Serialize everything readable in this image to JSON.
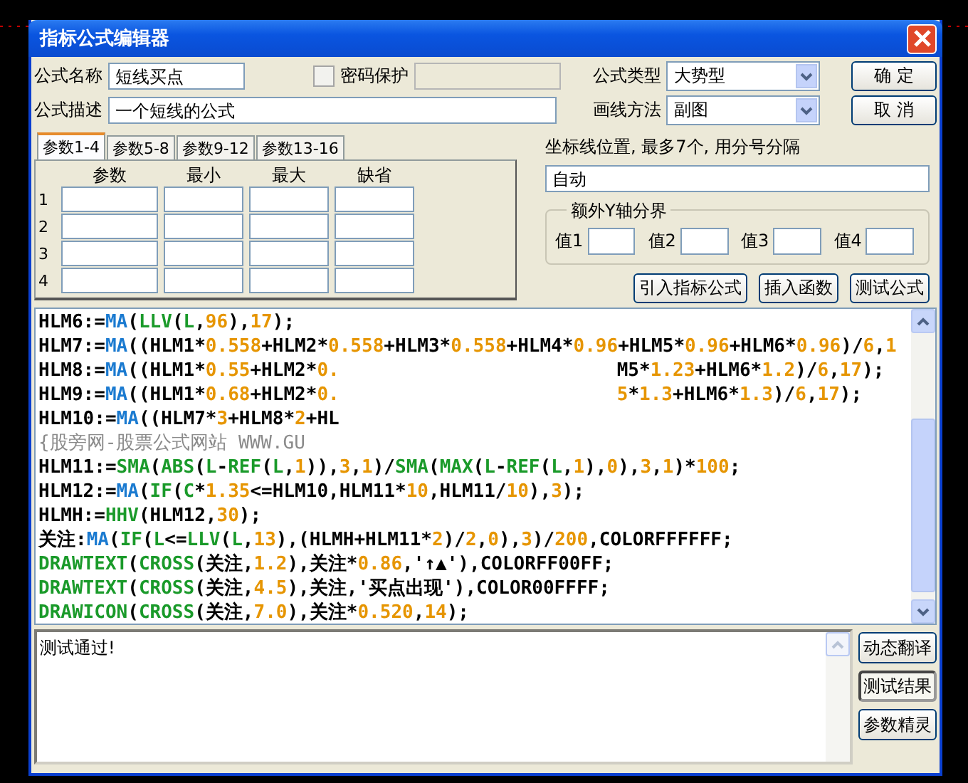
{
  "window": {
    "title": "指标公式编辑器"
  },
  "fields": {
    "name": {
      "label": "公式名称",
      "value": "短线买点"
    },
    "password": {
      "label": "密码保护",
      "checked": false
    },
    "description": {
      "label": "公式描述",
      "value": "一个短线的公式"
    },
    "formula_type": {
      "label": "公式类型",
      "value": "大势型"
    },
    "draw_method": {
      "label": "画线方法",
      "value": "副图"
    }
  },
  "buttons": [
    "确 定",
    "取 消"
  ],
  "param_tabs": [
    {
      "label": "参数1-4",
      "selected": true
    },
    {
      "label": "参数5-8",
      "selected": false
    },
    {
      "label": "参数9-12",
      "selected": false
    },
    {
      "label": "参数13-16",
      "selected": false
    }
  ],
  "param_table": {
    "columns": [
      "参数",
      "最小",
      "最大",
      "缺省"
    ],
    "rows": [
      "1",
      "2",
      "3",
      "4"
    ]
  },
  "axis_lines": {
    "label": "坐标线位置, 最多7个, 用分号分隔",
    "value": "自动"
  },
  "y_bounds": {
    "title": "额外Y轴分界",
    "fields": [
      "值1",
      "值2",
      "值3",
      "值4"
    ]
  },
  "actions": [
    "引入指标公式",
    "插入函数",
    "测试公式"
  ],
  "code": {
    "lines": [
      {
        "runs": [
          [
            {
              "text": "HLM6:=",
              "kind": "plain"
            },
            {
              "text": "MA",
              "kind": "function"
            },
            {
              "text": "(",
              "kind": "plain"
            },
            {
              "text": "LLV",
              "kind": "builtin"
            },
            {
              "text": "(",
              "kind": "plain"
            },
            {
              "text": "L",
              "kind": "builtin"
            },
            {
              "text": ",",
              "kind": "plain"
            },
            {
              "text": "96",
              "kind": "number"
            },
            {
              "text": "),",
              "kind": "plain"
            },
            {
              "text": "17",
              "kind": "number"
            },
            {
              "text": ");",
              "kind": "plain"
            }
          ]
        ]
      },
      {
        "runs": [
          [
            {
              "text": "HLM7:=",
              "kind": "plain"
            },
            {
              "text": "MA",
              "kind": "function"
            },
            {
              "text": "((HLM1*",
              "kind": "plain"
            },
            {
              "text": "0.558",
              "kind": "number"
            },
            {
              "text": "+HLM2*",
              "kind": "plain"
            },
            {
              "text": "0.558",
              "kind": "number"
            },
            {
              "text": "+HLM3*",
              "kind": "plain"
            },
            {
              "text": "0.558",
              "kind": "number"
            },
            {
              "text": "+HLM4*",
              "kind": "plain"
            },
            {
              "text": "0.96",
              "kind": "number"
            },
            {
              "text": "+HLM5*",
              "kind": "plain"
            },
            {
              "text": "0.96",
              "kind": "number"
            },
            {
              "text": "+HLM6*",
              "kind": "plain"
            },
            {
              "text": "0.96",
              "kind": "number"
            },
            {
              "text": ")/",
              "kind": "plain"
            },
            {
              "text": "6",
              "kind": "number"
            },
            {
              "text": ",",
              "kind": "plain"
            },
            {
              "text": "1",
              "kind": "number"
            }
          ]
        ]
      },
      {
        "runs": [
          [
            {
              "text": "HLM8:=",
              "kind": "plain"
            },
            {
              "text": "MA",
              "kind": "function"
            },
            {
              "text": "((HLM1*",
              "kind": "plain"
            },
            {
              "text": "0.55",
              "kind": "number"
            },
            {
              "text": "+HLM2*",
              "kind": "plain"
            },
            {
              "text": "0.",
              "kind": "number"
            }
          ],
          [
            {
              "text": "M5*",
              "kind": "plain"
            },
            {
              "text": "1.23",
              "kind": "number"
            },
            {
              "text": "+HLM6*",
              "kind": "plain"
            },
            {
              "text": "1.2",
              "kind": "number"
            },
            {
              "text": ")/",
              "kind": "plain"
            },
            {
              "text": "6",
              "kind": "number"
            },
            {
              "text": ",",
              "kind": "plain"
            },
            {
              "text": "17",
              "kind": "number"
            },
            {
              "text": ");",
              "kind": "plain"
            }
          ]
        ]
      },
      {
        "runs": [
          [
            {
              "text": "HLM9:=",
              "kind": "plain"
            },
            {
              "text": "MA",
              "kind": "function"
            },
            {
              "text": "((HLM1*",
              "kind": "plain"
            },
            {
              "text": "0.68",
              "kind": "number"
            },
            {
              "text": "+HLM2*",
              "kind": "plain"
            },
            {
              "text": "0.",
              "kind": "number"
            }
          ],
          [
            {
              "text": "5",
              "kind": "number"
            },
            {
              "text": "*",
              "kind": "plain"
            },
            {
              "text": "1.3",
              "kind": "number"
            },
            {
              "text": "+HLM6*",
              "kind": "plain"
            },
            {
              "text": "1.3",
              "kind": "number"
            },
            {
              "text": ")/",
              "kind": "plain"
            },
            {
              "text": "6",
              "kind": "number"
            },
            {
              "text": ",",
              "kind": "plain"
            },
            {
              "text": "17",
              "kind": "number"
            },
            {
              "text": ");",
              "kind": "plain"
            }
          ]
        ]
      },
      {
        "runs": [
          [
            {
              "text": "HLM10:=",
              "kind": "plain"
            },
            {
              "text": "MA",
              "kind": "function"
            },
            {
              "text": "((HLM7*",
              "kind": "plain"
            },
            {
              "text": "3",
              "kind": "number"
            },
            {
              "text": "+HLM8*",
              "kind": "plain"
            },
            {
              "text": "2",
              "kind": "number"
            },
            {
              "text": "+HL",
              "kind": "plain"
            }
          ]
        ]
      },
      {
        "runs": [
          [
            {
              "text": "{股旁网-股票公式网站 WWW.GU",
              "kind": "comment"
            }
          ]
        ]
      },
      {
        "runs": [
          [
            {
              "text": "HLM11:=",
              "kind": "plain"
            },
            {
              "text": "SMA",
              "kind": "builtin"
            },
            {
              "text": "(",
              "kind": "plain"
            },
            {
              "text": "ABS",
              "kind": "builtin"
            },
            {
              "text": "(",
              "kind": "plain"
            },
            {
              "text": "L",
              "kind": "builtin"
            },
            {
              "text": "-",
              "kind": "plain"
            },
            {
              "text": "REF",
              "kind": "builtin"
            },
            {
              "text": "(",
              "kind": "plain"
            },
            {
              "text": "L",
              "kind": "builtin"
            },
            {
              "text": ",",
              "kind": "plain"
            },
            {
              "text": "1",
              "kind": "number"
            },
            {
              "text": ")),",
              "kind": "plain"
            },
            {
              "text": "3",
              "kind": "number"
            },
            {
              "text": ",",
              "kind": "plain"
            },
            {
              "text": "1",
              "kind": "number"
            },
            {
              "text": ")/",
              "kind": "plain"
            },
            {
              "text": "SMA",
              "kind": "builtin"
            },
            {
              "text": "(",
              "kind": "plain"
            },
            {
              "text": "MAX",
              "kind": "builtin"
            },
            {
              "text": "(",
              "kind": "plain"
            },
            {
              "text": "L",
              "kind": "builtin"
            },
            {
              "text": "-",
              "kind": "plain"
            },
            {
              "text": "REF",
              "kind": "builtin"
            },
            {
              "text": "(",
              "kind": "plain"
            },
            {
              "text": "L",
              "kind": "builtin"
            },
            {
              "text": ",",
              "kind": "plain"
            },
            {
              "text": "1",
              "kind": "number"
            },
            {
              "text": "),",
              "kind": "plain"
            },
            {
              "text": "0",
              "kind": "number"
            },
            {
              "text": "),",
              "kind": "plain"
            },
            {
              "text": "3",
              "kind": "number"
            },
            {
              "text": ",",
              "kind": "plain"
            },
            {
              "text": "1",
              "kind": "number"
            },
            {
              "text": ")*",
              "kind": "plain"
            },
            {
              "text": "100",
              "kind": "number"
            },
            {
              "text": ";",
              "kind": "plain"
            }
          ]
        ]
      },
      {
        "runs": [
          [
            {
              "text": "HLM12:=",
              "kind": "plain"
            },
            {
              "text": "MA",
              "kind": "function"
            },
            {
              "text": "(",
              "kind": "plain"
            },
            {
              "text": "IF",
              "kind": "builtin"
            },
            {
              "text": "(",
              "kind": "plain"
            },
            {
              "text": "C",
              "kind": "builtin"
            },
            {
              "text": "*",
              "kind": "plain"
            },
            {
              "text": "1.35",
              "kind": "number"
            },
            {
              "text": "<=HLM10,HLM11*",
              "kind": "plain"
            },
            {
              "text": "10",
              "kind": "number"
            },
            {
              "text": ",HLM11/",
              "kind": "plain"
            },
            {
              "text": "10",
              "kind": "number"
            },
            {
              "text": "),",
              "kind": "plain"
            },
            {
              "text": "3",
              "kind": "number"
            },
            {
              "text": ");",
              "kind": "plain"
            }
          ]
        ]
      },
      {
        "runs": [
          [
            {
              "text": "HLMH:=",
              "kind": "plain"
            },
            {
              "text": "HHV",
              "kind": "builtin"
            },
            {
              "text": "(HLM12,",
              "kind": "plain"
            },
            {
              "text": "30",
              "kind": "number"
            },
            {
              "text": ");",
              "kind": "plain"
            }
          ]
        ]
      },
      {
        "runs": [
          [
            {
              "text": "关注:",
              "kind": "plain"
            },
            {
              "text": "MA",
              "kind": "function"
            },
            {
              "text": "(",
              "kind": "plain"
            },
            {
              "text": "IF",
              "kind": "builtin"
            },
            {
              "text": "(",
              "kind": "plain"
            },
            {
              "text": "L",
              "kind": "builtin"
            },
            {
              "text": "<=",
              "kind": "plain"
            },
            {
              "text": "LLV",
              "kind": "builtin"
            },
            {
              "text": "(",
              "kind": "plain"
            },
            {
              "text": "L",
              "kind": "builtin"
            },
            {
              "text": ",",
              "kind": "plain"
            },
            {
              "text": "13",
              "kind": "number"
            },
            {
              "text": "),(HLMH+HLM11*",
              "kind": "plain"
            },
            {
              "text": "2",
              "kind": "number"
            },
            {
              "text": ")/",
              "kind": "plain"
            },
            {
              "text": "2",
              "kind": "number"
            },
            {
              "text": ",",
              "kind": "plain"
            },
            {
              "text": "0",
              "kind": "number"
            },
            {
              "text": "),",
              "kind": "plain"
            },
            {
              "text": "3",
              "kind": "number"
            },
            {
              "text": ")/",
              "kind": "plain"
            },
            {
              "text": "200",
              "kind": "number"
            },
            {
              "text": ",COLORFFFFFF;",
              "kind": "plain"
            }
          ]
        ]
      },
      {
        "runs": [
          [
            {
              "text": "DRAWTEXT",
              "kind": "builtin"
            },
            {
              "text": "(",
              "kind": "plain"
            },
            {
              "text": "CROSS",
              "kind": "builtin"
            },
            {
              "text": "(关注,",
              "kind": "plain"
            },
            {
              "text": "1.2",
              "kind": "number"
            },
            {
              "text": "),关注*",
              "kind": "plain"
            },
            {
              "text": "0.86",
              "kind": "number"
            },
            {
              "text": ",'↑▲'),COLORFF00FF;",
              "kind": "plain"
            }
          ]
        ]
      },
      {
        "runs": [
          [
            {
              "text": "DRAWTEXT",
              "kind": "builtin"
            },
            {
              "text": "(",
              "kind": "plain"
            },
            {
              "text": "CROSS",
              "kind": "builtin"
            },
            {
              "text": "(关注,",
              "kind": "plain"
            },
            {
              "text": "4.5",
              "kind": "number"
            },
            {
              "text": "),关注,'买点出现'),COLOR00FFFF;",
              "kind": "plain"
            }
          ]
        ]
      },
      {
        "runs": [
          [
            {
              "text": "DRAWICON",
              "kind": "builtin"
            },
            {
              "text": "(",
              "kind": "plain"
            },
            {
              "text": "CROSS",
              "kind": "builtin"
            },
            {
              "text": "(关注,",
              "kind": "plain"
            },
            {
              "text": "7.0",
              "kind": "number"
            },
            {
              "text": "),关注*",
              "kind": "plain"
            },
            {
              "text": "0.520",
              "kind": "number"
            },
            {
              "text": ",",
              "kind": "plain"
            },
            {
              "text": "14",
              "kind": "number"
            },
            {
              "text": ");",
              "kind": "plain"
            }
          ]
        ]
      }
    ]
  },
  "output": {
    "text": "测试通过!"
  },
  "side_buttons": [
    {
      "label": "动态翻译",
      "selected": false
    },
    {
      "label": "测试结果",
      "selected": true
    },
    {
      "label": "参数精灵",
      "selected": false
    }
  ]
}
